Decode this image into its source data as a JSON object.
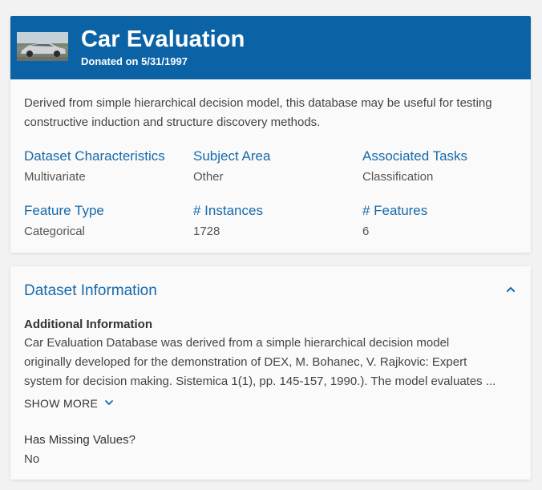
{
  "header": {
    "title": "Car Evaluation",
    "donated": "Donated on 5/31/1997",
    "background_color": "#0b63a6"
  },
  "description": "Derived from simple hierarchical decision model, this database may be useful for testing constructive induction and structure discovery methods.",
  "characteristics": [
    {
      "label": "Dataset Characteristics",
      "value": "Multivariate"
    },
    {
      "label": "Subject Area",
      "value": "Other"
    },
    {
      "label": "Associated Tasks",
      "value": "Classification"
    },
    {
      "label": "Feature Type",
      "value": "Categorical"
    },
    {
      "label": "# Instances",
      "value": "1728"
    },
    {
      "label": "# Features",
      "value": "6"
    }
  ],
  "dataset_information": {
    "section_title": "Dataset Information",
    "collapse_icon": "chevron-up-icon",
    "additional_info_label": "Additional Information",
    "additional_info_line1": "Car Evaluation Database was derived from a simple hierarchical decision model",
    "additional_info_line2": "originally developed for the demonstration of DEX, M. Bohanec, V. Rajkovic: Expert",
    "additional_info_line3": "system for decision making. Sistemica 1(1), pp. 145-157, 1990.). The model evaluates ...",
    "show_more_label": "SHOW MORE",
    "show_more_icon": "chevron-down-icon",
    "missing_values_label": "Has Missing Values?",
    "missing_values_value": "No"
  },
  "colors": {
    "accent": "#1769aa",
    "page_background": "#f2f2f2",
    "card_background": "#fafafa"
  }
}
